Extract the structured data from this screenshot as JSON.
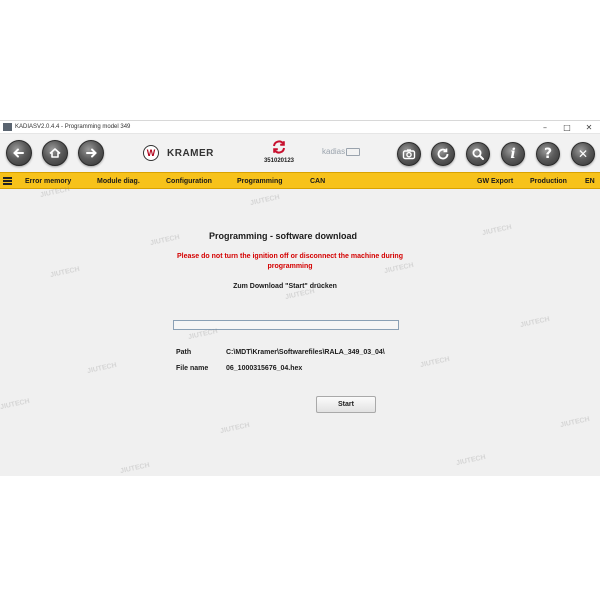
{
  "window": {
    "title": "KADIASV2.0.4.4 - Programming model 349",
    "controls": {
      "minimize": "–",
      "maximize": "□",
      "close": "✕"
    }
  },
  "toolbar": {
    "brand_logo_letter": "W",
    "brand_name": "KRAMER",
    "model_number": "351020123",
    "kadias_logo": "kadias",
    "icons": [
      "back-arrow-icon",
      "home-icon",
      "forward-arrow-icon",
      "camera-icon",
      "refresh-icon",
      "search-icon",
      "info-icon",
      "help-icon",
      "close-icon"
    ],
    "glyphs": {
      "info": "i",
      "help": "?",
      "close": "✕"
    }
  },
  "menu": {
    "items": [
      "Error memory",
      "Module diag.",
      "Configuration",
      "Programming",
      "CAN"
    ],
    "right_items": [
      "GW Export",
      "Production",
      "EN"
    ]
  },
  "main": {
    "heading": "Programming - software download",
    "warning_line1": "Please do not turn the ignition off or disconnect the machine during",
    "warning_line2": "programming",
    "instruction": "Zum Download \"Start\" drücken",
    "progress_fraction": 0,
    "path_label": "Path",
    "path_value": "C:\\MDT\\Kramer\\Softwarefiles\\RALA_349_03_04\\",
    "filename_label": "File name",
    "filename_value": "06_1000315676_04.hex",
    "start_button": "Start"
  },
  "watermark": "JIUTECH",
  "colors": {
    "menu_bar": "#f7c21a",
    "warning_text": "#d40000",
    "model_icon": "#c8102e"
  }
}
